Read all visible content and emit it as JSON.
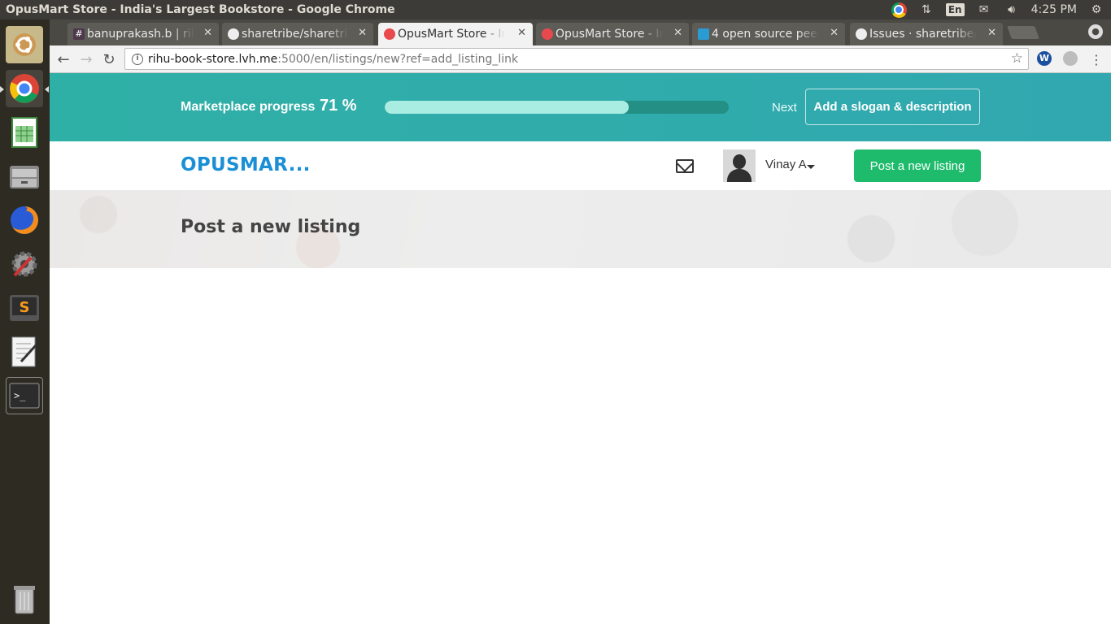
{
  "os": {
    "window_title": "OpusMart Store - India's Largest Bookstore - Google Chrome",
    "keyboard_layout": "En",
    "clock": "4:25 PM"
  },
  "browser": {
    "tabs": [
      {
        "label": "banuprakash.b | rih",
        "favicon": "slack-icon",
        "active": false
      },
      {
        "label": "sharetribe/sharetri",
        "favicon": "github-icon",
        "active": false
      },
      {
        "label": "OpusMart Store - In",
        "favicon": "sharetribe-icon",
        "active": true
      },
      {
        "label": "OpusMart Store - In",
        "favicon": "sharetribe-icon",
        "active": false
      },
      {
        "label": "4 open source peer",
        "favicon": "site-icon",
        "active": false
      },
      {
        "label": "Issues · sharetribe/",
        "favicon": "github-icon",
        "active": false
      }
    ],
    "url_host": "rihu-book-store.lvh.me",
    "url_rest": ":5000/en/listings/new?ref=add_listing_link"
  },
  "progress": {
    "label": "Marketplace progress",
    "percent_text": "71 %",
    "percent": 71,
    "next_label": "Next",
    "next_button": "Add a slogan & description"
  },
  "header": {
    "logo": "OPUSMAR...",
    "user_name": "Vinay A",
    "post_button": "Post a new listing"
  },
  "hero": {
    "title": "Post a new listing"
  },
  "colors": {
    "teal": "#2fb0a6",
    "green_button": "#1dbb6b",
    "logo_blue": "#1a8fd6"
  }
}
